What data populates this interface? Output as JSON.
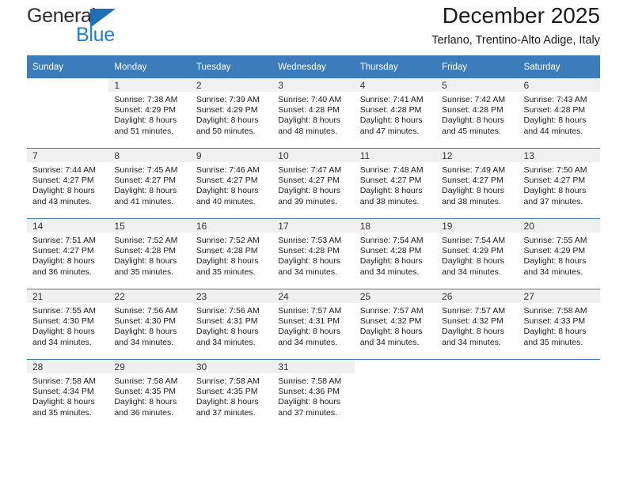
{
  "brand": {
    "name_top": "General",
    "name_bottom": "Blue",
    "triangle_icon": "triangle-icon",
    "accent_color": "#1f7fd0",
    "header_color": "#3c7cba"
  },
  "header": {
    "title": "December 2025",
    "subtitle": "Terlano, Trentino-Alto Adige, Italy"
  },
  "weekdays": [
    "Sunday",
    "Monday",
    "Tuesday",
    "Wednesday",
    "Thursday",
    "Friday",
    "Saturday"
  ],
  "weeks": [
    [
      {
        "day": ""
      },
      {
        "day": "1",
        "sunrise": "Sunrise: 7:38 AM",
        "sunset": "Sunset: 4:29 PM",
        "daylight1": "Daylight: 8 hours",
        "daylight2": "and 51 minutes."
      },
      {
        "day": "2",
        "sunrise": "Sunrise: 7:39 AM",
        "sunset": "Sunset: 4:29 PM",
        "daylight1": "Daylight: 8 hours",
        "daylight2": "and 50 minutes."
      },
      {
        "day": "3",
        "sunrise": "Sunrise: 7:40 AM",
        "sunset": "Sunset: 4:28 PM",
        "daylight1": "Daylight: 8 hours",
        "daylight2": "and 48 minutes."
      },
      {
        "day": "4",
        "sunrise": "Sunrise: 7:41 AM",
        "sunset": "Sunset: 4:28 PM",
        "daylight1": "Daylight: 8 hours",
        "daylight2": "and 47 minutes."
      },
      {
        "day": "5",
        "sunrise": "Sunrise: 7:42 AM",
        "sunset": "Sunset: 4:28 PM",
        "daylight1": "Daylight: 8 hours",
        "daylight2": "and 45 minutes."
      },
      {
        "day": "6",
        "sunrise": "Sunrise: 7:43 AM",
        "sunset": "Sunset: 4:28 PM",
        "daylight1": "Daylight: 8 hours",
        "daylight2": "and 44 minutes."
      }
    ],
    [
      {
        "day": "7",
        "sunrise": "Sunrise: 7:44 AM",
        "sunset": "Sunset: 4:27 PM",
        "daylight1": "Daylight: 8 hours",
        "daylight2": "and 43 minutes."
      },
      {
        "day": "8",
        "sunrise": "Sunrise: 7:45 AM",
        "sunset": "Sunset: 4:27 PM",
        "daylight1": "Daylight: 8 hours",
        "daylight2": "and 41 minutes."
      },
      {
        "day": "9",
        "sunrise": "Sunrise: 7:46 AM",
        "sunset": "Sunset: 4:27 PM",
        "daylight1": "Daylight: 8 hours",
        "daylight2": "and 40 minutes."
      },
      {
        "day": "10",
        "sunrise": "Sunrise: 7:47 AM",
        "sunset": "Sunset: 4:27 PM",
        "daylight1": "Daylight: 8 hours",
        "daylight2": "and 39 minutes."
      },
      {
        "day": "11",
        "sunrise": "Sunrise: 7:48 AM",
        "sunset": "Sunset: 4:27 PM",
        "daylight1": "Daylight: 8 hours",
        "daylight2": "and 38 minutes."
      },
      {
        "day": "12",
        "sunrise": "Sunrise: 7:49 AM",
        "sunset": "Sunset: 4:27 PM",
        "daylight1": "Daylight: 8 hours",
        "daylight2": "and 38 minutes."
      },
      {
        "day": "13",
        "sunrise": "Sunrise: 7:50 AM",
        "sunset": "Sunset: 4:27 PM",
        "daylight1": "Daylight: 8 hours",
        "daylight2": "and 37 minutes."
      }
    ],
    [
      {
        "day": "14",
        "sunrise": "Sunrise: 7:51 AM",
        "sunset": "Sunset: 4:27 PM",
        "daylight1": "Daylight: 8 hours",
        "daylight2": "and 36 minutes."
      },
      {
        "day": "15",
        "sunrise": "Sunrise: 7:52 AM",
        "sunset": "Sunset: 4:28 PM",
        "daylight1": "Daylight: 8 hours",
        "daylight2": "and 35 minutes."
      },
      {
        "day": "16",
        "sunrise": "Sunrise: 7:52 AM",
        "sunset": "Sunset: 4:28 PM",
        "daylight1": "Daylight: 8 hours",
        "daylight2": "and 35 minutes."
      },
      {
        "day": "17",
        "sunrise": "Sunrise: 7:53 AM",
        "sunset": "Sunset: 4:28 PM",
        "daylight1": "Daylight: 8 hours",
        "daylight2": "and 34 minutes."
      },
      {
        "day": "18",
        "sunrise": "Sunrise: 7:54 AM",
        "sunset": "Sunset: 4:28 PM",
        "daylight1": "Daylight: 8 hours",
        "daylight2": "and 34 minutes."
      },
      {
        "day": "19",
        "sunrise": "Sunrise: 7:54 AM",
        "sunset": "Sunset: 4:29 PM",
        "daylight1": "Daylight: 8 hours",
        "daylight2": "and 34 minutes."
      },
      {
        "day": "20",
        "sunrise": "Sunrise: 7:55 AM",
        "sunset": "Sunset: 4:29 PM",
        "daylight1": "Daylight: 8 hours",
        "daylight2": "and 34 minutes."
      }
    ],
    [
      {
        "day": "21",
        "sunrise": "Sunrise: 7:55 AM",
        "sunset": "Sunset: 4:30 PM",
        "daylight1": "Daylight: 8 hours",
        "daylight2": "and 34 minutes."
      },
      {
        "day": "22",
        "sunrise": "Sunrise: 7:56 AM",
        "sunset": "Sunset: 4:30 PM",
        "daylight1": "Daylight: 8 hours",
        "daylight2": "and 34 minutes."
      },
      {
        "day": "23",
        "sunrise": "Sunrise: 7:56 AM",
        "sunset": "Sunset: 4:31 PM",
        "daylight1": "Daylight: 8 hours",
        "daylight2": "and 34 minutes."
      },
      {
        "day": "24",
        "sunrise": "Sunrise: 7:57 AM",
        "sunset": "Sunset: 4:31 PM",
        "daylight1": "Daylight: 8 hours",
        "daylight2": "and 34 minutes."
      },
      {
        "day": "25",
        "sunrise": "Sunrise: 7:57 AM",
        "sunset": "Sunset: 4:32 PM",
        "daylight1": "Daylight: 8 hours",
        "daylight2": "and 34 minutes."
      },
      {
        "day": "26",
        "sunrise": "Sunrise: 7:57 AM",
        "sunset": "Sunset: 4:32 PM",
        "daylight1": "Daylight: 8 hours",
        "daylight2": "and 34 minutes."
      },
      {
        "day": "27",
        "sunrise": "Sunrise: 7:58 AM",
        "sunset": "Sunset: 4:33 PM",
        "daylight1": "Daylight: 8 hours",
        "daylight2": "and 35 minutes."
      }
    ],
    [
      {
        "day": "28",
        "sunrise": "Sunrise: 7:58 AM",
        "sunset": "Sunset: 4:34 PM",
        "daylight1": "Daylight: 8 hours",
        "daylight2": "and 35 minutes."
      },
      {
        "day": "29",
        "sunrise": "Sunrise: 7:58 AM",
        "sunset": "Sunset: 4:35 PM",
        "daylight1": "Daylight: 8 hours",
        "daylight2": "and 36 minutes."
      },
      {
        "day": "30",
        "sunrise": "Sunrise: 7:58 AM",
        "sunset": "Sunset: 4:35 PM",
        "daylight1": "Daylight: 8 hours",
        "daylight2": "and 37 minutes."
      },
      {
        "day": "31",
        "sunrise": "Sunrise: 7:58 AM",
        "sunset": "Sunset: 4:36 PM",
        "daylight1": "Daylight: 8 hours",
        "daylight2": "and 37 minutes."
      },
      {
        "day": ""
      },
      {
        "day": ""
      },
      {
        "day": ""
      }
    ]
  ]
}
